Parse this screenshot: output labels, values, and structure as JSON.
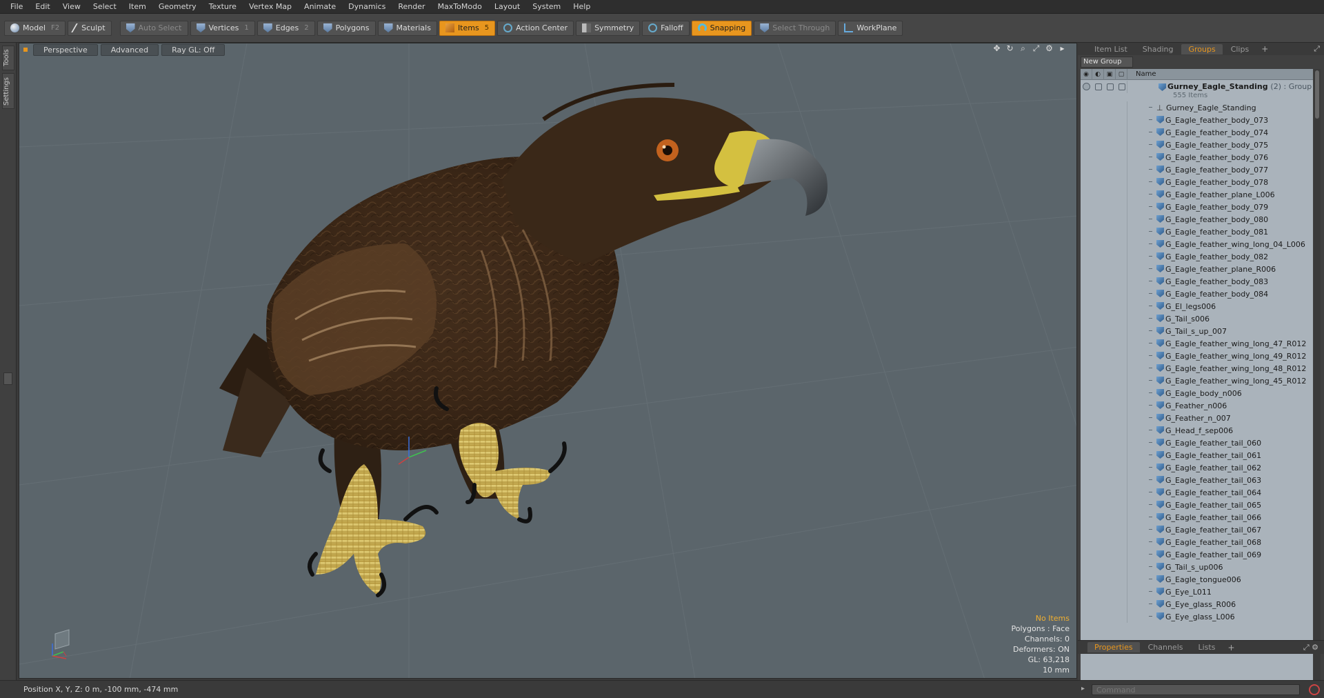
{
  "menubar": {
    "items": [
      "File",
      "Edit",
      "View",
      "Select",
      "Item",
      "Geometry",
      "Texture",
      "Vertex Map",
      "Animate",
      "Dynamics",
      "Render",
      "MaxToModo",
      "Layout",
      "System",
      "Help"
    ]
  },
  "toolbar": {
    "model": {
      "label": "Model",
      "key": "F2"
    },
    "sculpt": {
      "label": "Sculpt"
    },
    "auto_select": {
      "label": "Auto Select"
    },
    "vertices": {
      "label": "Vertices",
      "key": "1"
    },
    "edges": {
      "label": "Edges",
      "key": "2"
    },
    "polygons": {
      "label": "Polygons"
    },
    "materials": {
      "label": "Materials"
    },
    "items": {
      "label": "Items",
      "key": "5"
    },
    "action_center": {
      "label": "Action Center"
    },
    "symmetry": {
      "label": "Symmetry"
    },
    "falloff": {
      "label": "Falloff"
    },
    "snapping": {
      "label": "Snapping"
    },
    "select_through": {
      "label": "Select Through"
    },
    "workplane": {
      "label": "WorkPlane"
    }
  },
  "left_strip": {
    "tools": "Tools",
    "settings": "Settings"
  },
  "viewport": {
    "view_mode": "Perspective",
    "shading": "Advanced",
    "raygl": "Ray GL: Off",
    "info": {
      "items": "No Items",
      "polygons": "Polygons : Face",
      "channels": "Channels: 0",
      "deformers": "Deformers: ON",
      "gl": "GL: 63,218",
      "scale": "10 mm"
    },
    "colors": {
      "background": "#5b656b",
      "warn": "#f2b030"
    }
  },
  "right_panel": {
    "tabs": [
      "Item List",
      "Shading",
      "Groups",
      "Clips"
    ],
    "active_tab": "Groups",
    "new_group": "New Group",
    "name_header": "Name",
    "group": {
      "name": "Gurney_Eagle_Standing",
      "suffix": "(2) : Group",
      "count": "555 Items"
    },
    "locator": "Gurney_Eagle_Standing",
    "items": [
      "G_Eagle_feather_body_073",
      "G_Eagle_feather_body_074",
      "G_Eagle_feather_body_075",
      "G_Eagle_feather_body_076",
      "G_Eagle_feather_body_077",
      "G_Eagle_feather_body_078",
      "G_Eagle_feather_plane_L006",
      "G_Eagle_feather_body_079",
      "G_Eagle_feather_body_080",
      "G_Eagle_feather_body_081",
      "G_Eagle_feather_wing_long_04_L006",
      "G_Eagle_feather_body_082",
      "G_Eagle_feather_plane_R006",
      "G_Eagle_feather_body_083",
      "G_Eagle_feather_body_084",
      "G_El_legs006",
      "G_Tail_s006",
      "G_Tail_s_up_007",
      "G_Eagle_feather_wing_long_47_R012",
      "G_Eagle_feather_wing_long_49_R012",
      "G_Eagle_feather_wing_long_48_R012",
      "G_Eagle_feather_wing_long_45_R012",
      "G_Eagle_body_n006",
      "G_Feather_n006",
      "G_Feather_n_007",
      "G_Head_f_sep006",
      "G_Eagle_feather_tail_060",
      "G_Eagle_feather_tail_061",
      "G_Eagle_feather_tail_062",
      "G_Eagle_feather_tail_063",
      "G_Eagle_feather_tail_064",
      "G_Eagle_feather_tail_065",
      "G_Eagle_feather_tail_066",
      "G_Eagle_feather_tail_067",
      "G_Eagle_feather_tail_068",
      "G_Eagle_feather_tail_069",
      "G_Tail_s_up006",
      "G_Eagle_tongue006",
      "G_Eye_L011",
      "G_Eye_glass_R006",
      "G_Eye_glass_L006"
    ],
    "props_tabs": [
      "Properties",
      "Channels",
      "Lists"
    ],
    "props_active": "Properties",
    "colors": {
      "accent": "#e8961e",
      "list_bg": "#aab3bb"
    }
  },
  "statusbar": {
    "position": "Position X, Y, Z:  0 m, -100 mm, -474 mm"
  },
  "command": {
    "placeholder": "Command"
  }
}
